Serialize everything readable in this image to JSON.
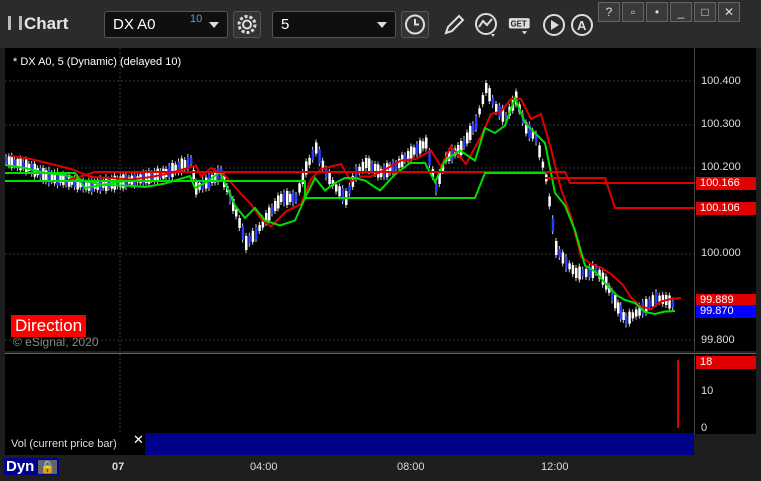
{
  "app": {
    "title": "Chart"
  },
  "toolbar": {
    "symbol": "DX A0",
    "symbol_badge": "10",
    "interval": "5"
  },
  "chart": {
    "header": "* DX A0, 5 (Dynamic) (delayed 10)",
    "study_label": "Direction",
    "watermark": "© eSignal, 2020"
  },
  "price_axis": {
    "ticks": [
      "100.400",
      "100.300",
      "100.200",
      "100.000",
      "99.800"
    ],
    "flags": [
      {
        "text": "100.166",
        "color": "#e00000"
      },
      {
        "text": "100.106",
        "color": "#e00000"
      },
      {
        "text": "99.889",
        "color": "#e00000"
      },
      {
        "text": "99.870",
        "color": "#0000ff"
      }
    ]
  },
  "volume": {
    "label": "Vol (current price bar)",
    "ticks": [
      "10",
      "0"
    ],
    "flag": "18"
  },
  "time_axis": {
    "ticks": [
      "07",
      "04:00",
      "08:00",
      "12:00"
    ]
  },
  "footer": {
    "mode": "Dyn"
  }
}
